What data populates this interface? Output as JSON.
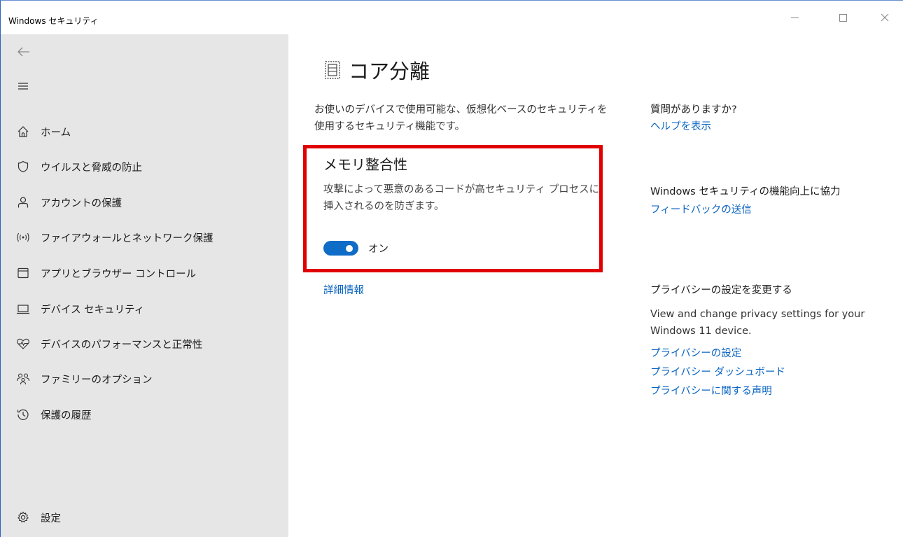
{
  "window": {
    "title": "Windows セキュリティ"
  },
  "sidebar": {
    "items": [
      {
        "label": "ホーム",
        "icon": "home-icon"
      },
      {
        "label": "ウイルスと脅威の防止",
        "icon": "shield-icon"
      },
      {
        "label": "アカウントの保護",
        "icon": "person-icon"
      },
      {
        "label": "ファイアウォールとネットワーク保護",
        "icon": "wifi-antenna-icon"
      },
      {
        "label": "アプリとブラウザー コントロール",
        "icon": "app-window-icon"
      },
      {
        "label": "デバイス セキュリティ",
        "icon": "laptop-icon"
      },
      {
        "label": "デバイスのパフォーマンスと正常性",
        "icon": "heart-pulse-icon"
      },
      {
        "label": "ファミリーのオプション",
        "icon": "family-icon"
      },
      {
        "label": "保護の履歴",
        "icon": "history-icon"
      }
    ],
    "settings_label": "設定"
  },
  "main": {
    "title": "コア分離",
    "description": "お使いのデバイスで使用可能な、仮想化ベースのセキュリティを使用するセキュリティ機能です。",
    "memory_integrity": {
      "title": "メモリ整合性",
      "description": "攻撃によって悪意のあるコードが高セキュリティ プロセスに挿入されるのを防ぎます。",
      "toggle_state": "オン",
      "toggle_on": true
    },
    "detail_link": "詳細情報"
  },
  "right": {
    "help_heading": "質問がありますか?",
    "help_link": "ヘルプを表示",
    "feedback_heading": "Windows セキュリティの機能向上に協力",
    "feedback_link": "フィードバックの送信",
    "privacy_heading": "プライバシーの設定を変更する",
    "privacy_body": "View and change privacy settings for your Windows 11 device.",
    "privacy_links": [
      "プライバシーの設定",
      "プライバシー ダッシュボード",
      "プライバシーに関する声明"
    ]
  },
  "colors": {
    "accent": "#0f6cc7",
    "link": "#0a64c2",
    "highlight_border": "#e00000",
    "sidebar_bg": "#e6e6e6"
  }
}
